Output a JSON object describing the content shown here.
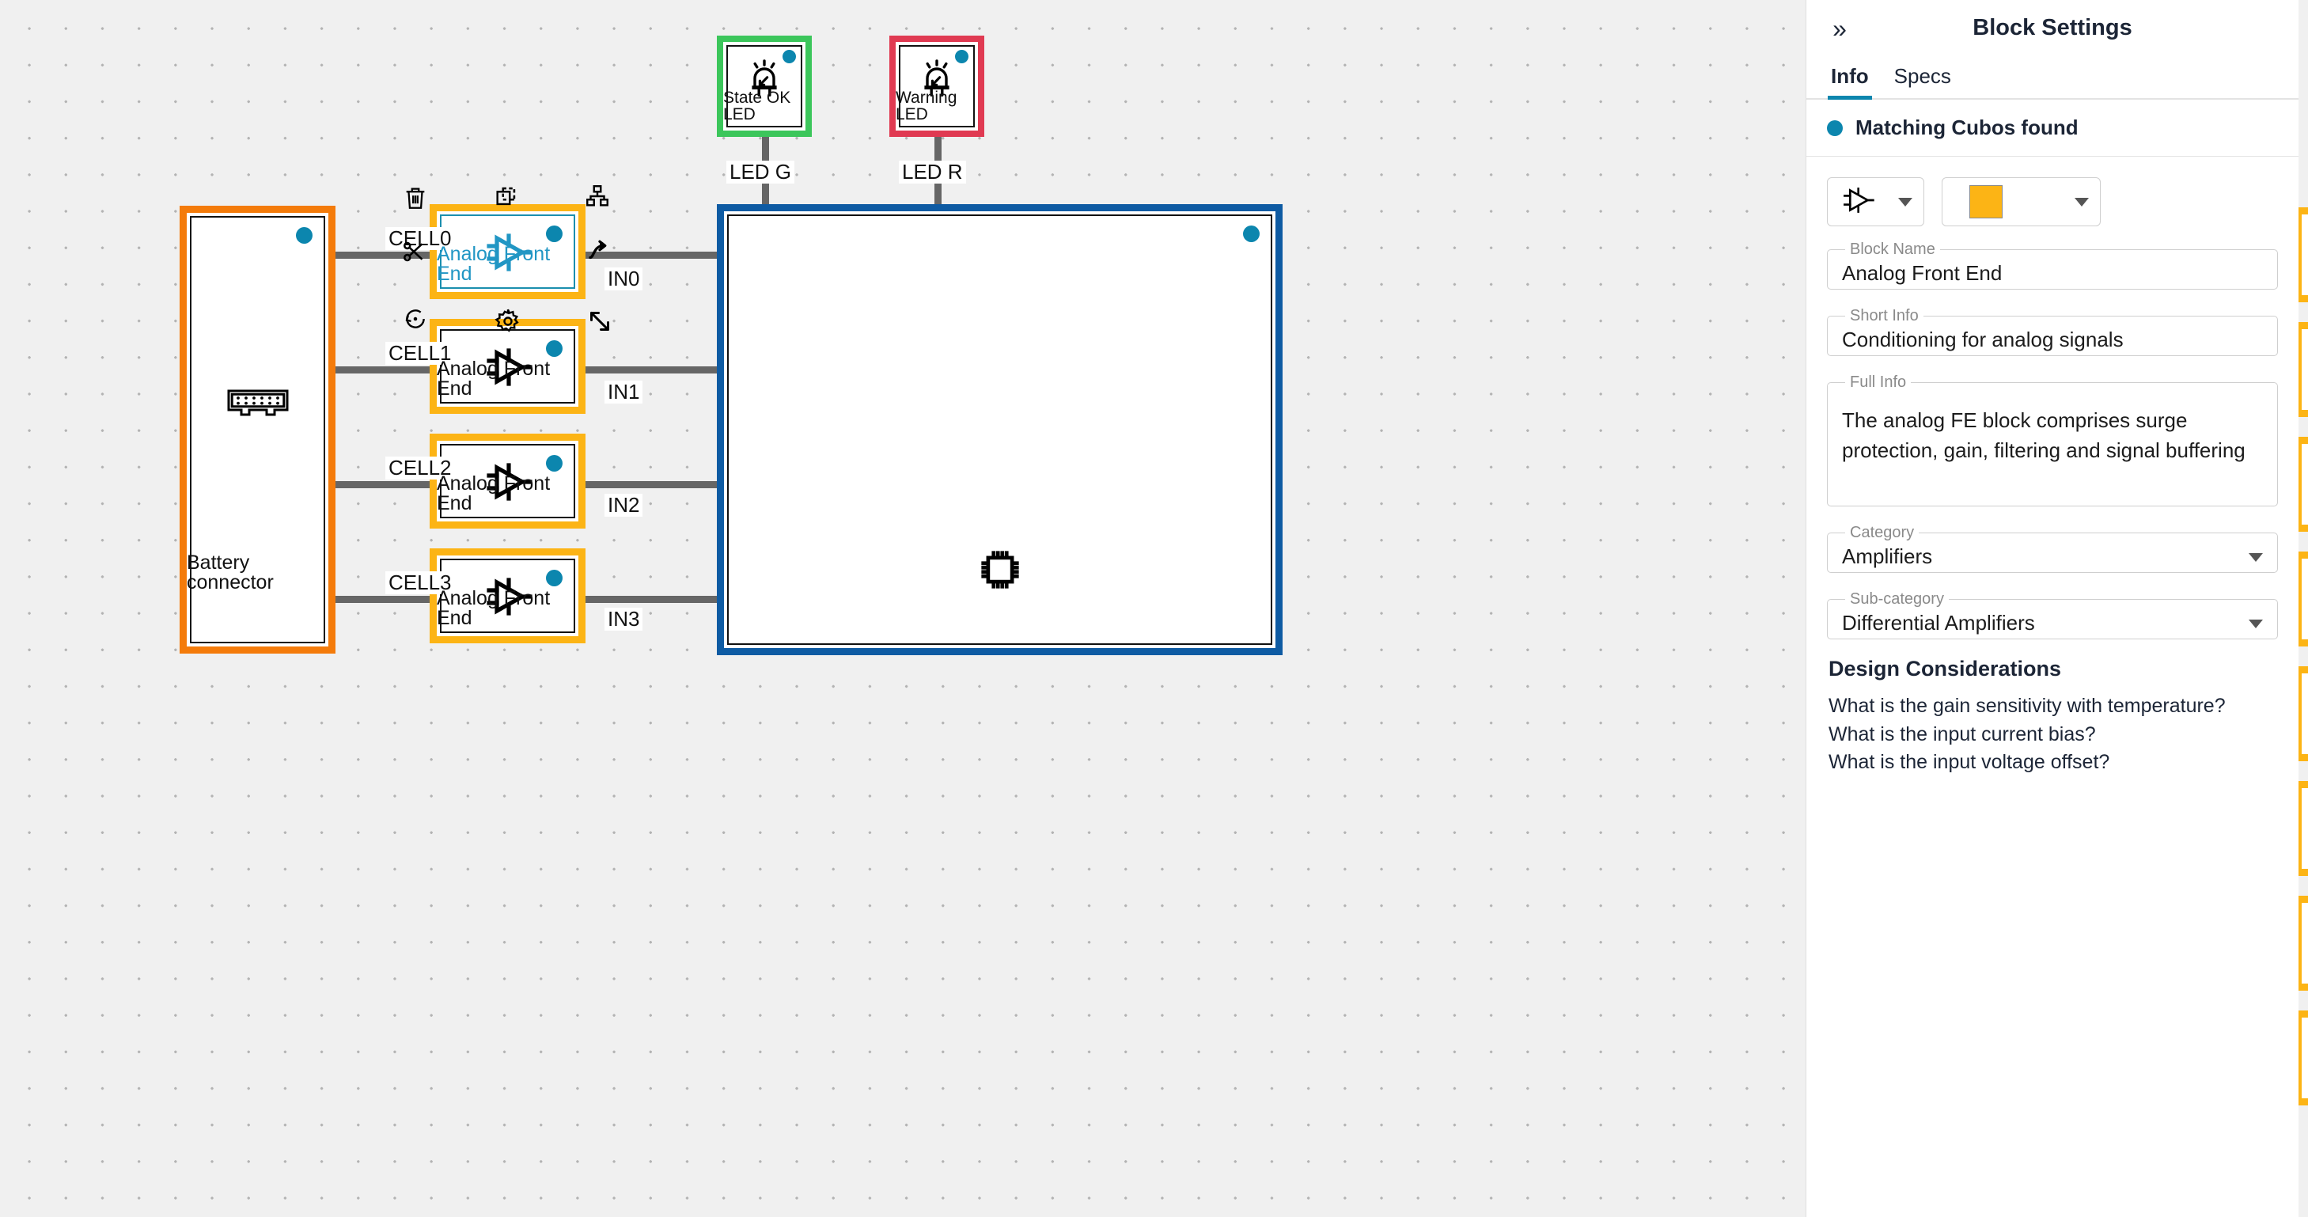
{
  "canvas": {
    "blocks": [
      {
        "id": "battery",
        "label": "Battery connector",
        "icon": "connector-icon",
        "accent": "#f47b0a",
        "selected": false
      },
      {
        "id": "afe0",
        "label": "Analog Front End",
        "icon": "amplifier-icon",
        "accent": "#fcb415",
        "selected": true
      },
      {
        "id": "afe1",
        "label": "Analog Front End",
        "icon": "amplifier-icon",
        "accent": "#fcb415",
        "selected": false
      },
      {
        "id": "afe2",
        "label": "Analog Front End",
        "icon": "amplifier-icon",
        "accent": "#fcb415",
        "selected": false
      },
      {
        "id": "afe3",
        "label": "Analog Front End",
        "icon": "amplifier-icon",
        "accent": "#fcb415",
        "selected": false
      },
      {
        "id": "led-green",
        "label": "State OK LED",
        "icon": "led-icon",
        "accent": "#3cc65b",
        "selected": false
      },
      {
        "id": "led-red",
        "label": "Warning LED",
        "icon": "led-icon",
        "accent": "#e03a52",
        "selected": false
      },
      {
        "id": "mcu",
        "label": "",
        "icon": "microchip-icon",
        "accent": "#0e5ba3",
        "selected": false
      }
    ],
    "wire_labels": {
      "cell0": "CELL0",
      "cell1": "CELL1",
      "cell2": "CELL2",
      "cell3": "CELL3",
      "in0": "IN0",
      "in1": "IN1",
      "in2": "IN2",
      "in3": "IN3",
      "led_g": "LED G",
      "led_r": "LED R"
    },
    "selection_tools": [
      {
        "name": "delete-icon",
        "title": "Delete"
      },
      {
        "name": "duplicate-icon",
        "title": "Duplicate"
      },
      {
        "name": "hierarchy-icon",
        "title": "Group"
      },
      {
        "name": "cut-icon",
        "title": "Cut"
      },
      {
        "name": "rotate-icon",
        "title": "Rotate"
      },
      {
        "name": "settings-icon",
        "title": "Settings"
      },
      {
        "name": "connect-icon",
        "title": "Connect"
      },
      {
        "name": "resize-icon",
        "title": "Resize"
      }
    ]
  },
  "panel": {
    "title": "Block Settings",
    "collapse_glyph": "»",
    "tabs": [
      {
        "label": "Info",
        "active": true
      },
      {
        "label": "Specs",
        "active": false
      }
    ],
    "status": "Matching Cubos found",
    "status_color": "#0c86ae",
    "symbol_dropdown": {
      "icon": "amplifier-icon",
      "caret": "chevron-down-icon"
    },
    "color_dropdown": {
      "value": "#FCB415",
      "caret": "chevron-down-icon"
    },
    "fields": [
      {
        "key": "block_name",
        "label": "Block Name",
        "value": "Analog Front End"
      },
      {
        "key": "short_info",
        "label": "Short Info",
        "value": "Conditioning for analog signals"
      },
      {
        "key": "full_info",
        "label": "Full Info",
        "value": "The analog FE block comprises surge protection, gain, filtering and signal buffering"
      },
      {
        "key": "category",
        "label": "Category",
        "value": "Amplifiers"
      },
      {
        "key": "sub_category",
        "label": "Sub-category",
        "value": "Differential Amplifiers"
      }
    ],
    "design": {
      "title": "Design Considerations",
      "items": [
        "What is the gain sensitivity with temperature?",
        "What is the input current bias?",
        "What is the input voltage offset?"
      ]
    }
  }
}
